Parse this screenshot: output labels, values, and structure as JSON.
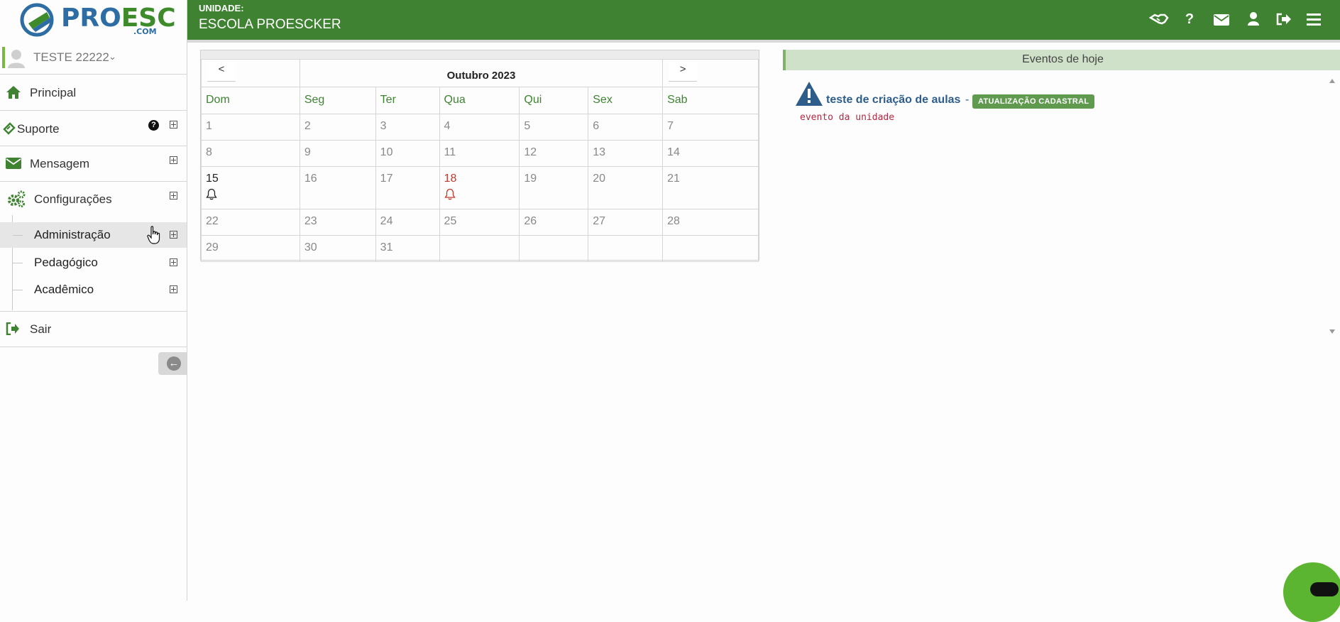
{
  "brand": {
    "logo_pro": "PRO",
    "logo_esc": "ESC",
    "logo_com": ".COM"
  },
  "header": {
    "unit_label": "UNIDADE:",
    "unit_name": "ESCOLA PROESCKER",
    "icons": [
      "handshake-icon",
      "help-icon",
      "envelope-icon",
      "user-icon",
      "logout-icon",
      "menu-icon"
    ]
  },
  "sidebar": {
    "user_name": "TESTE 22222",
    "items": [
      {
        "label": "Principal",
        "icon": "home-icon"
      },
      {
        "label": "Suporte",
        "icon": "ticket-icon"
      },
      {
        "label": "Mensagem",
        "icon": "envelope-icon"
      },
      {
        "label": "Configurações",
        "icon": "cogs-icon"
      }
    ],
    "subitems": [
      {
        "label": "Administração",
        "active": true
      },
      {
        "label": "Pedagógico"
      },
      {
        "label": "Acadêmico"
      }
    ],
    "logout": {
      "label": "Sair",
      "icon": "sign-out-icon"
    }
  },
  "calendar": {
    "prev": "<",
    "next": ">",
    "month": "Outubro 2023",
    "weekdays": [
      "Dom",
      "Seg",
      "Ter",
      "Qua",
      "Qui",
      "Sex",
      "Sab"
    ],
    "weeks": [
      [
        "1",
        "2",
        "3",
        "4",
        "5",
        "6",
        "7"
      ],
      [
        "8",
        "9",
        "10",
        "11",
        "12",
        "13",
        "14"
      ],
      [
        "15",
        "16",
        "17",
        "18",
        "19",
        "20",
        "21"
      ],
      [
        "22",
        "23",
        "24",
        "25",
        "26",
        "27",
        "28"
      ],
      [
        "29",
        "30",
        "31",
        "",
        "",
        "",
        ""
      ]
    ],
    "today": "15",
    "event_days": [
      "15",
      "18"
    ]
  },
  "events": {
    "header": "Eventos de hoje",
    "items": [
      {
        "title": "teste de criação de aulas",
        "separator": "-",
        "badge": "ATUALIZAÇÃO CADASTRAL",
        "description": "evento da unidade"
      }
    ]
  },
  "colors": {
    "primary_green": "#3f8332",
    "events_header_bg": "#cfe1c8",
    "event_title": "#2e5d8c",
    "event_desc": "#b02a42",
    "badge": "#5f9a4f"
  }
}
